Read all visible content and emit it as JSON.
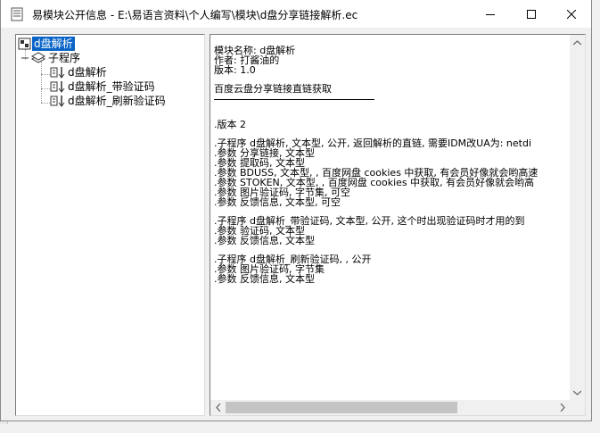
{
  "window": {
    "title": "易模块公开信息 - E:\\易语言资料\\个人编写\\模块\\d盘分享链接解析.ec",
    "icon": "document-icon",
    "controls": [
      "minimize",
      "maximize",
      "close"
    ]
  },
  "tree": {
    "root": "d盘解析",
    "group": "子程序",
    "children": [
      "d盘解析",
      "d盘解析_带验证码",
      "d盘解析_刷新验证码"
    ]
  },
  "content": {
    "header": [
      "模块名称: d盘解析",
      "作者: 打酱油的",
      "版本: 1.0"
    ],
    "description": "百度云盘分享链接直链获取",
    "version_line": ".版本 2",
    "block1": [
      ".子程序 d盘解析, 文本型, 公开, 返回解析的直链, 需要IDM改UA为: netdi",
      ".参数 分享链接, 文本型",
      ".参数 提取码, 文本型",
      ".参数 BDUSS, 文本型, , 百度网盘 cookies 中获取, 有会员好像就会哟高速",
      ".参数 STOKEN, 文本型, , 百度网盘 cookies 中获取, 有会员好像就会哟高",
      ".参数 图片验证码, 字节集, 可空",
      ".参数 反馈信息, 文本型, 可空"
    ],
    "block2": [
      ".子程序 d盘解析_带验证码, 文本型, 公开, 这个时出现验证码时才用的到",
      ".参数 验证码, 文本型",
      ".参数 反馈信息, 文本型"
    ],
    "block3": [
      ".子程序 d盘解析_刷新验证码, , 公开",
      ".参数 图片验证码, 字节集",
      ".参数 反馈信息, 文本型"
    ]
  },
  "colors": {
    "selection": "#0a64c8",
    "window_bg": "#f0f0f0"
  }
}
